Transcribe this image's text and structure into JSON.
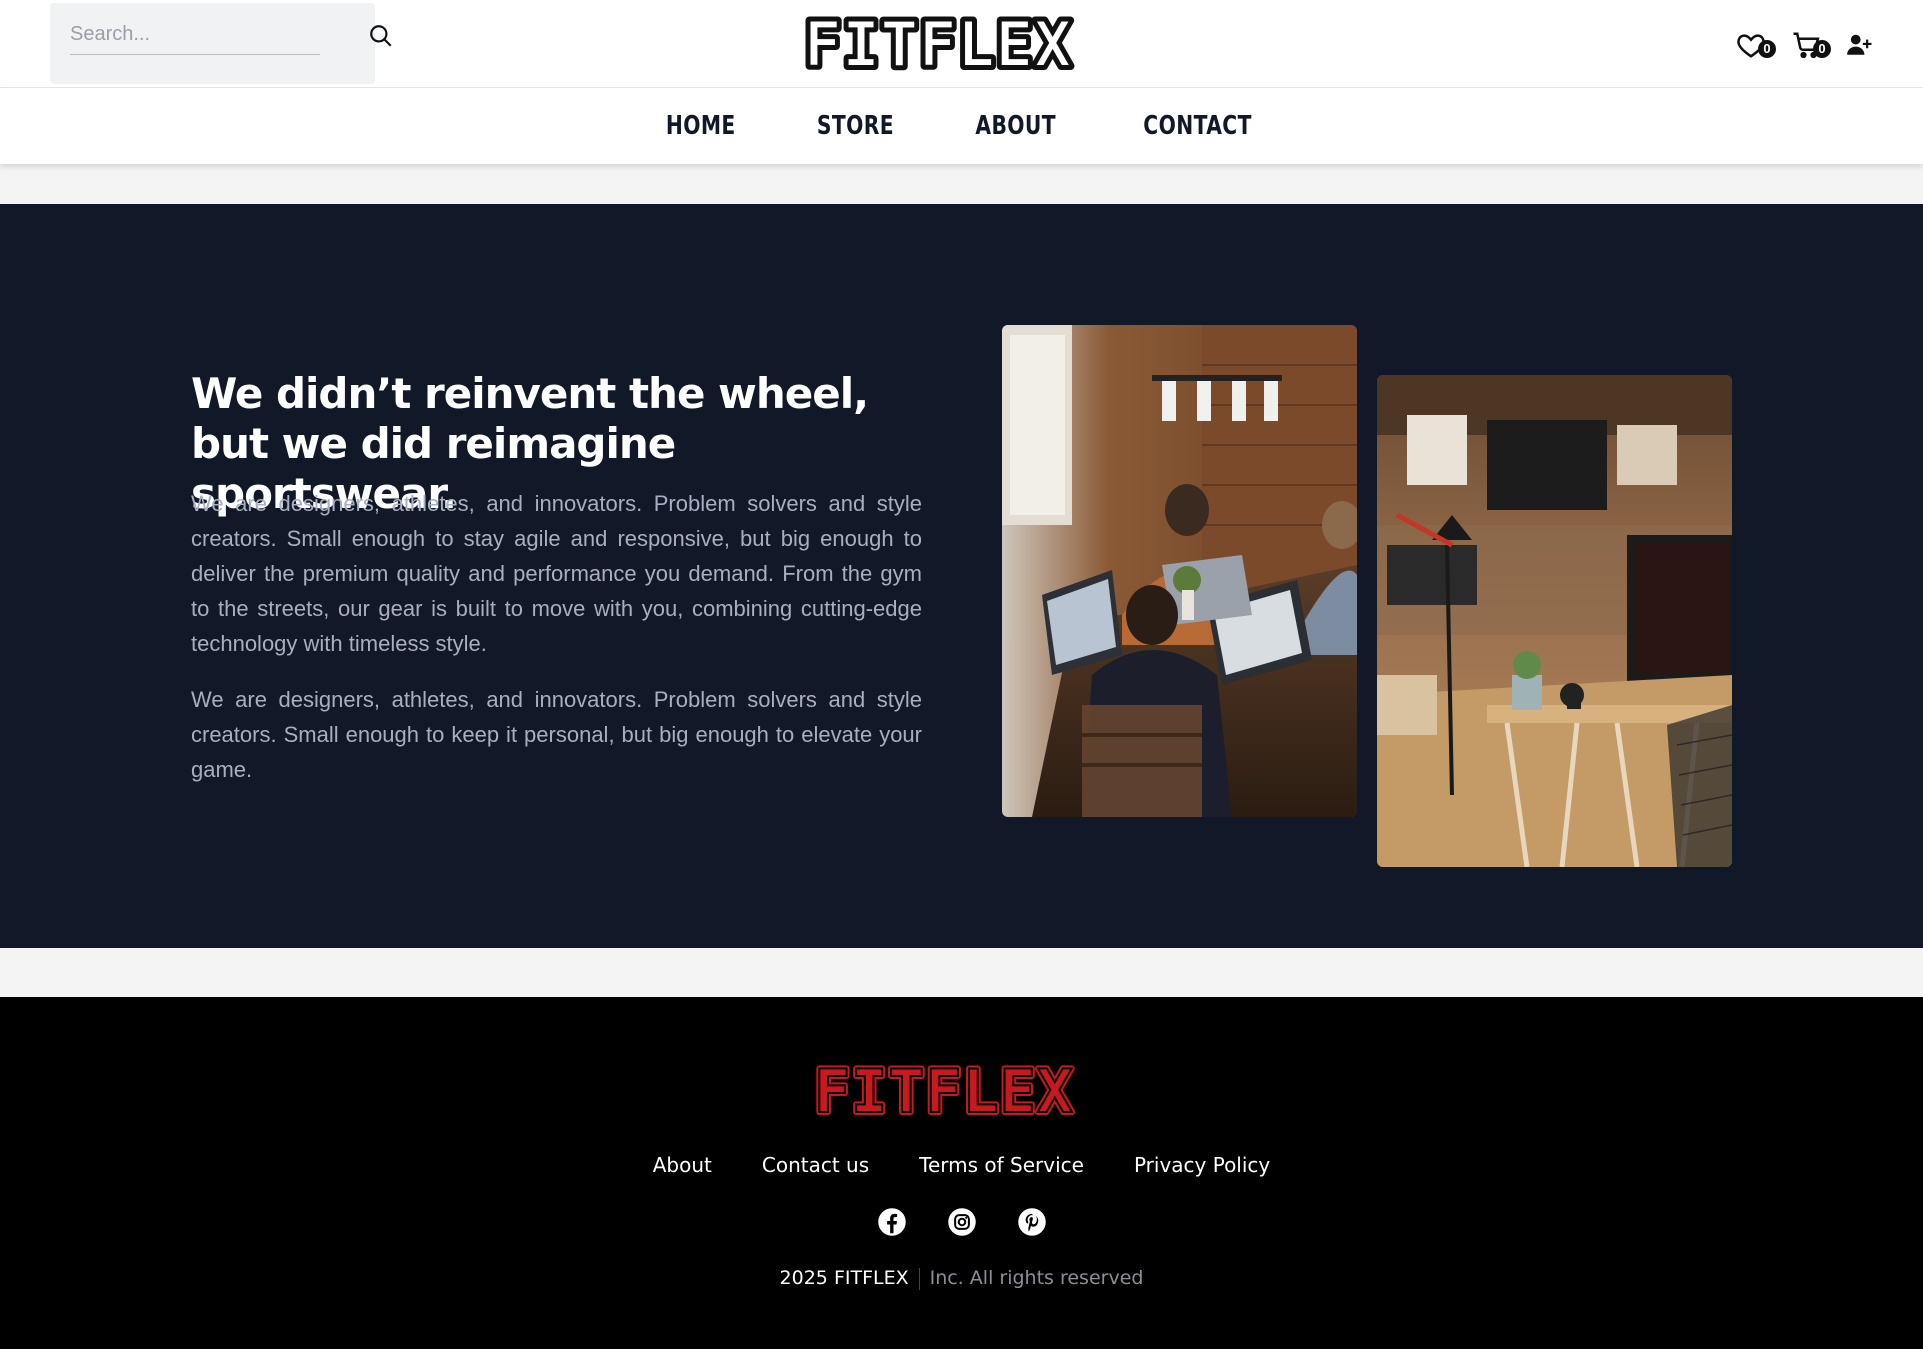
{
  "header": {
    "search": {
      "placeholder": "Search...",
      "value": ""
    },
    "logo_text": "FITFLEX",
    "wishlist_count": "0",
    "cart_count": "0",
    "icons": [
      "search-icon",
      "heart-icon",
      "cart-icon",
      "user-add-icon"
    ]
  },
  "nav": {
    "items": [
      {
        "label": "HOME"
      },
      {
        "label": "STORE"
      },
      {
        "label": "ABOUT"
      },
      {
        "label": "CONTACT"
      }
    ]
  },
  "hero": {
    "title": "We didn’t reinvent the wheel, but we did reimagine sportswear.",
    "paragraph_1": "We are designers, athletes, and innovators. Problem solvers and style creators. Small enough to stay agile and responsive, but big enough to deliver the premium quality and performance you demand. From the gym to the streets, our gear is built to move with you, combining cutting-edge technology with timeless style.",
    "paragraph_2": "We are designers, athletes, and innovators. Problem solvers and style creators. Small enough to keep it personal, but big enough to elevate your game."
  },
  "footer": {
    "logo_text": "FITFLEX",
    "links": [
      {
        "label": "About"
      },
      {
        "label": "Contact us"
      },
      {
        "label": "Terms of Service"
      },
      {
        "label": "Privacy Policy"
      }
    ],
    "socials": [
      "facebook-icon",
      "instagram-icon",
      "pinterest-icon"
    ],
    "copyright_brand": "2025 FITFLEX",
    "copyright_rest": "Inc. All rights reserved"
  },
  "colors": {
    "hero_bg": "#111827",
    "footer_bg": "#000000",
    "footer_logo": "#c8191f",
    "nav_text": "#111827",
    "muted_text": "#a7afc0"
  }
}
